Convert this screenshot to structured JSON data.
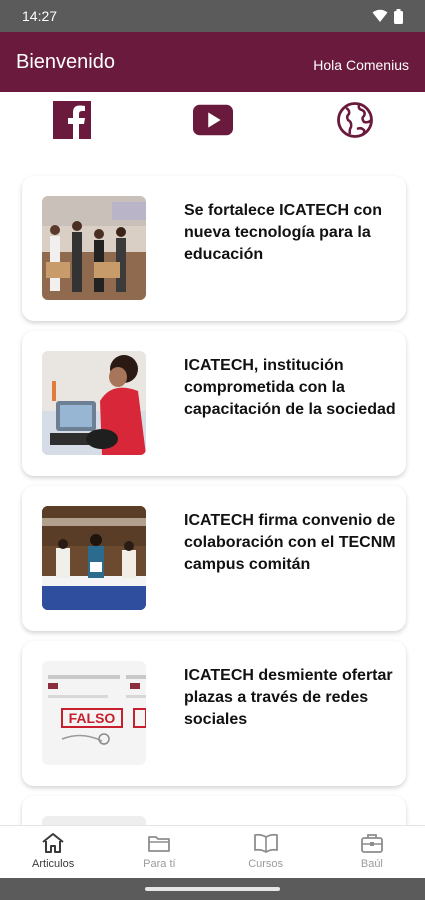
{
  "status": {
    "time": "14:27"
  },
  "appbar": {
    "title": "Bienvenido",
    "greeting": "Hola Comenius"
  },
  "social": [
    "facebook-icon",
    "youtube-icon",
    "globe-icon"
  ],
  "colors": {
    "brand": "#6a1a3c",
    "statusbar": "#5b5b5b"
  },
  "articles": [
    {
      "title": "Se fortalece ICATECH con nueva tecnología para la educación"
    },
    {
      "title": "ICATECH, institución comprometida con la capacitación de la sociedad"
    },
    {
      "title": "ICATECH firma convenio de colaboración con el TECNM campus comitán"
    },
    {
      "title": "ICATECH desmiente ofertar plazas a través de redes sociales"
    },
    {
      "title": ""
    }
  ],
  "thumb_stamp": "FALSO",
  "nav": [
    {
      "label": "Articulos",
      "icon": "home-icon"
    },
    {
      "label": "Para tí",
      "icon": "folder-icon"
    },
    {
      "label": "Cursos",
      "icon": "book-icon"
    },
    {
      "label": "Baúl",
      "icon": "briefcase-icon"
    }
  ]
}
